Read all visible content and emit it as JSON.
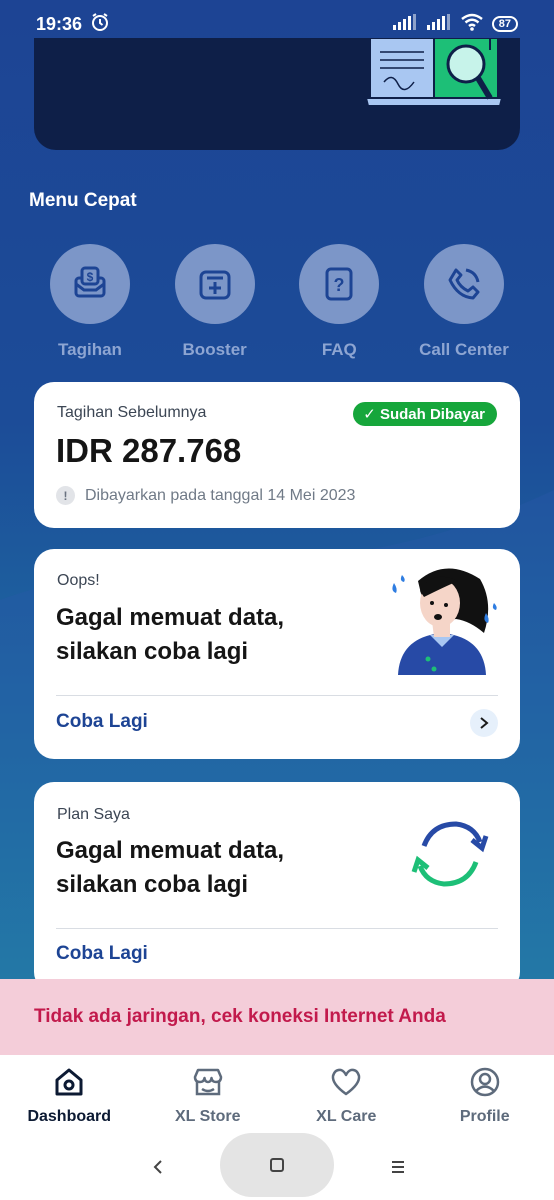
{
  "status_bar": {
    "time": "19:36",
    "battery": "87"
  },
  "quick_menu": {
    "title": "Menu Cepat",
    "items": [
      {
        "label": "Tagihan",
        "icon": "bill-icon"
      },
      {
        "label": "Booster",
        "icon": "booster-icon"
      },
      {
        "label": "FAQ",
        "icon": "faq-icon"
      },
      {
        "label": "Call Center",
        "icon": "phone-icon"
      }
    ]
  },
  "previous_bill": {
    "label": "Tagihan Sebelumnya",
    "status": "Sudah Dibayar",
    "amount": "IDR 287.768",
    "note": "Dibayarkan pada tanggal 14 Mei 2023"
  },
  "error_card": {
    "label": "Oops!",
    "line1": "Gagal memuat data,",
    "line2": "silakan coba lagi",
    "retry": "Coba Lagi"
  },
  "plan_card": {
    "label": "Plan Saya",
    "line1": "Gagal memuat data,",
    "line2": "silakan coba lagi",
    "retry": "Coba Lagi"
  },
  "network_banner": "Tidak ada jaringan, cek koneksi Internet Anda",
  "bottom_nav": [
    {
      "label": "Dashboard",
      "icon": "home-icon",
      "active": true
    },
    {
      "label": "XL Store",
      "icon": "store-icon",
      "active": false
    },
    {
      "label": "XL Care",
      "icon": "heart-icon",
      "active": false
    },
    {
      "label": "Profile",
      "icon": "profile-icon",
      "active": false
    }
  ],
  "colors": {
    "brand_blue": "#1d4494",
    "paid_green": "#16a63b",
    "error_text": "#c21a4c",
    "banner_bg": "#f4cdd9"
  }
}
